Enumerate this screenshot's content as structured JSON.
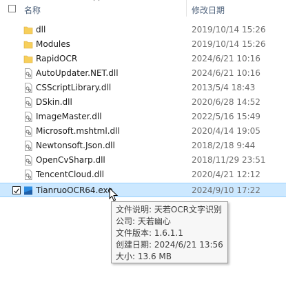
{
  "header": {
    "name_label": "名称",
    "date_label": "修改日期",
    "sort_icon": "chevron-up-icon"
  },
  "files": [
    {
      "name": "dll",
      "date": "2019/10/14 15:26",
      "type": "folder"
    },
    {
      "name": "Modules",
      "date": "2019/10/14 15:26",
      "type": "folder"
    },
    {
      "name": "RapidOCR",
      "date": "2024/6/21 10:16",
      "type": "folder"
    },
    {
      "name": "AutoUpdater.NET.dll",
      "date": "2024/6/21 10:16",
      "type": "dll"
    },
    {
      "name": "CSScriptLibrary.dll",
      "date": "2013/5/4 18:43",
      "type": "dll"
    },
    {
      "name": "DSkin.dll",
      "date": "2020/6/28 14:52",
      "type": "dll"
    },
    {
      "name": "ImageMaster.dll",
      "date": "2022/5/16 15:49",
      "type": "dll"
    },
    {
      "name": "Microsoft.mshtml.dll",
      "date": "2020/4/14 19:05",
      "type": "dll"
    },
    {
      "name": "Newtonsoft.Json.dll",
      "date": "2018/2/18 9:44",
      "type": "dll"
    },
    {
      "name": "OpenCvSharp.dll",
      "date": "2018/11/29 23:51",
      "type": "dll"
    },
    {
      "name": "TencentCloud.dll",
      "date": "2020/4/21 12:12",
      "type": "dll"
    },
    {
      "name": "TianruoOCR64.exe",
      "date": "2024/9/10 17:22",
      "type": "exe",
      "selected": true,
      "checked": true
    }
  ],
  "tooltip": {
    "description": "文件说明: 天若OCR文字识别",
    "company": "公司: 天若幽心",
    "version": "文件版本: 1.6.1.1",
    "created": "创建日期: 2024/6/21 13:56",
    "size": "大小: 13.6 MB"
  },
  "colors": {
    "folder": "#f7cf5b",
    "selection": "#cce8ff",
    "exe_icon": "#2a8ae0"
  }
}
